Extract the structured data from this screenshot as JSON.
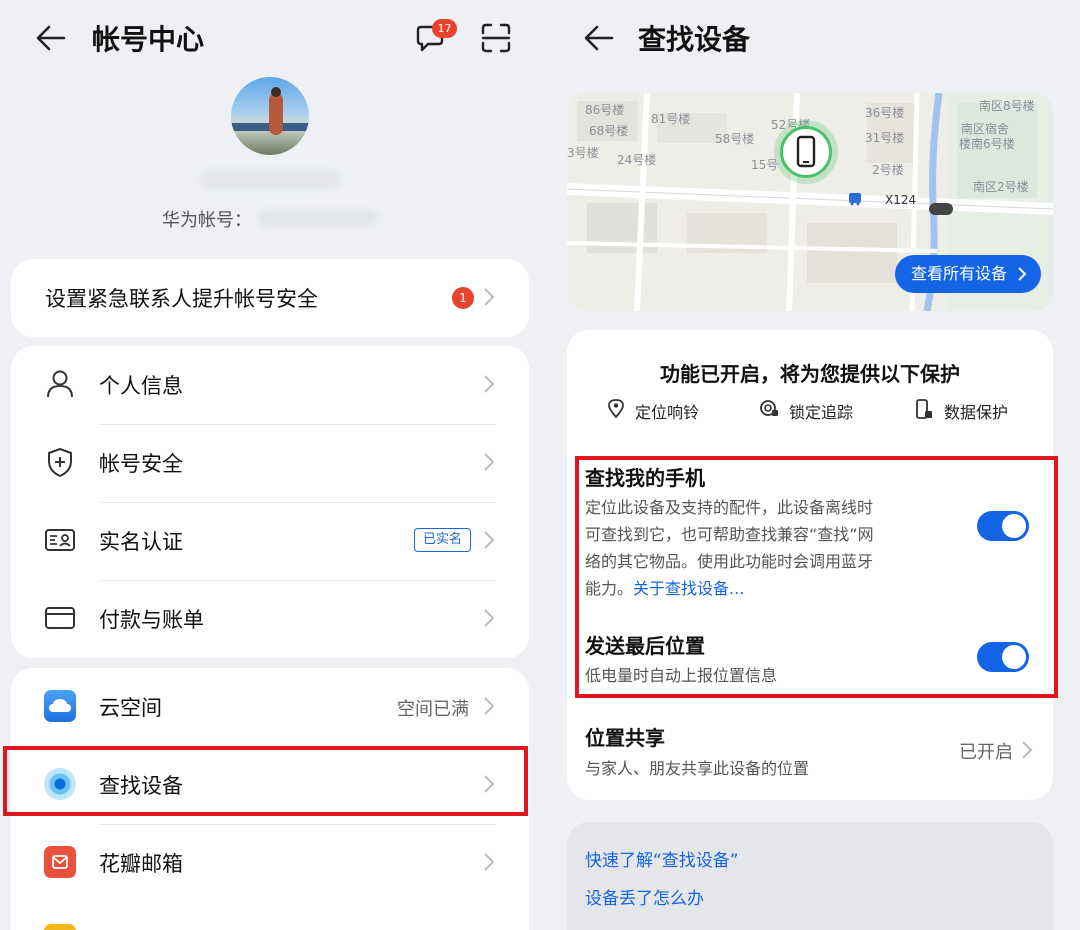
{
  "left": {
    "title": "帐号中心",
    "message_badge": "17",
    "account_label": "华为帐号：",
    "emergency": {
      "label": "设置紧急联系人提升帐号安全",
      "badge": "1"
    },
    "items": [
      {
        "label": "个人信息"
      },
      {
        "label": "帐号安全"
      },
      {
        "label": "实名认证",
        "tag": "已实名"
      },
      {
        "label": "付款与账单"
      }
    ],
    "services": [
      {
        "label": "云空间",
        "status": "空间已满"
      },
      {
        "label": "查找设备"
      },
      {
        "label": "花瓣邮箱"
      }
    ]
  },
  "right": {
    "title": "查找设备",
    "map": {
      "view_all_button": "查看所有设备",
      "labels": [
        "86号楼",
        "81号楼",
        "68号楼",
        "58号楼",
        "52号楼",
        "36号楼",
        "31号楼",
        "3号楼",
        "24号楼",
        "15号",
        "2号楼",
        "X124",
        "南区8号楼",
        "南区宿舍",
        "楼南6号楼",
        "南区2号楼"
      ]
    },
    "protection": {
      "heading": "功能已开启，将为您提供以下保护",
      "features": [
        "定位响铃",
        "锁定追踪",
        "数据保护"
      ]
    },
    "find_phone": {
      "title": "查找我的手机",
      "desc_lines": [
        "定位此设备及支持的配件，此设备离线时",
        "可查找到它，也可帮助查找兼容“查找”网",
        "络的其它物品。使用此功能时会调用蓝牙"
      ],
      "desc_last": "能力。",
      "link": "关于查找设备..."
    },
    "send_last": {
      "title": "发送最后位置",
      "desc": "低电量时自动上报位置信息"
    },
    "location_share": {
      "title": "位置共享",
      "desc": "与家人、朋友共享此设备的位置",
      "status": "已开启"
    },
    "help_links": [
      "快速了解“查找设备”",
      "设备丢了怎么办"
    ]
  },
  "colors": {
    "accent": "#1464e6",
    "highlight_box": "#e0161e",
    "badge": "#e8432d"
  }
}
